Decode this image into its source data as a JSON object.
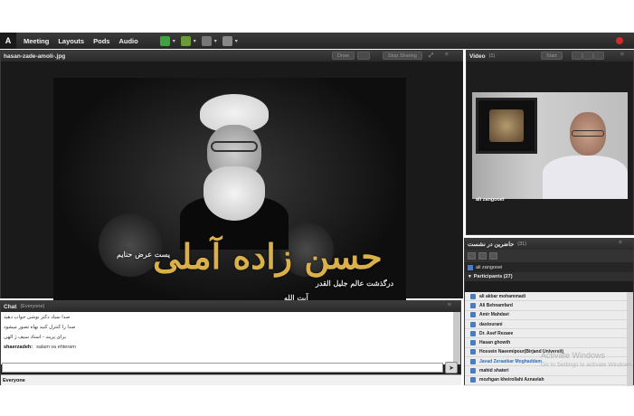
{
  "menubar": {
    "items": [
      "Meeting",
      "Layouts",
      "Pods",
      "Audio"
    ]
  },
  "share_pod": {
    "title": "hasan-zade-amoli-.jpg",
    "buttons": [
      "Draw",
      "Stop Sharing"
    ],
    "poster": {
      "calligraphy_main": "حسن زاده آملی",
      "calligraphy_top": "یست عرض حنایم",
      "calligraphy_sub": "درگذشت عالم جلیل القدر",
      "calligraphy_sub2": "آیت الله"
    }
  },
  "video_pod": {
    "title": "Video",
    "count": "(1)",
    "start_label": "Start",
    "participant_name": "ali zangooei"
  },
  "attendee_pod": {
    "title": "حاضرین در نشست",
    "count": "(31)",
    "host_name": "ali zangooei",
    "participants_header": "Participants (27)",
    "participants": [
      "ali akbar mohammadi",
      "Ali Behnamfard",
      "Amir Mahdavi",
      "dastourani",
      "Dr. Asef Rezaee",
      "Hasan ghowth",
      "Hossein Naeemipour(Birjand Universit)",
      "Javad Zeraatkar Moghaddam",
      "mahid shateri",
      "mozhgan kheirollahi Aznavlah"
    ],
    "highlighted_index": 7
  },
  "watermark": {
    "line1": "Activate Windows",
    "line2": "Go to Settings to activate Windows."
  },
  "chat_pod": {
    "title": "Chat",
    "scope": "(Everyone)",
    "messages": [
      {
        "user": "",
        "text": "صدا نمیاد دکتر نوشی جواب دهید"
      },
      {
        "user": "",
        "text": "صدا را کنترل کنید بهاه تصور میشود"
      },
      {
        "user": "",
        "text": "برای پریند - استاد سیف ژ الهی"
      },
      {
        "user": "shaerzadeh:",
        "text": "salam va ehteram"
      }
    ],
    "recipient": "Everyone"
  }
}
